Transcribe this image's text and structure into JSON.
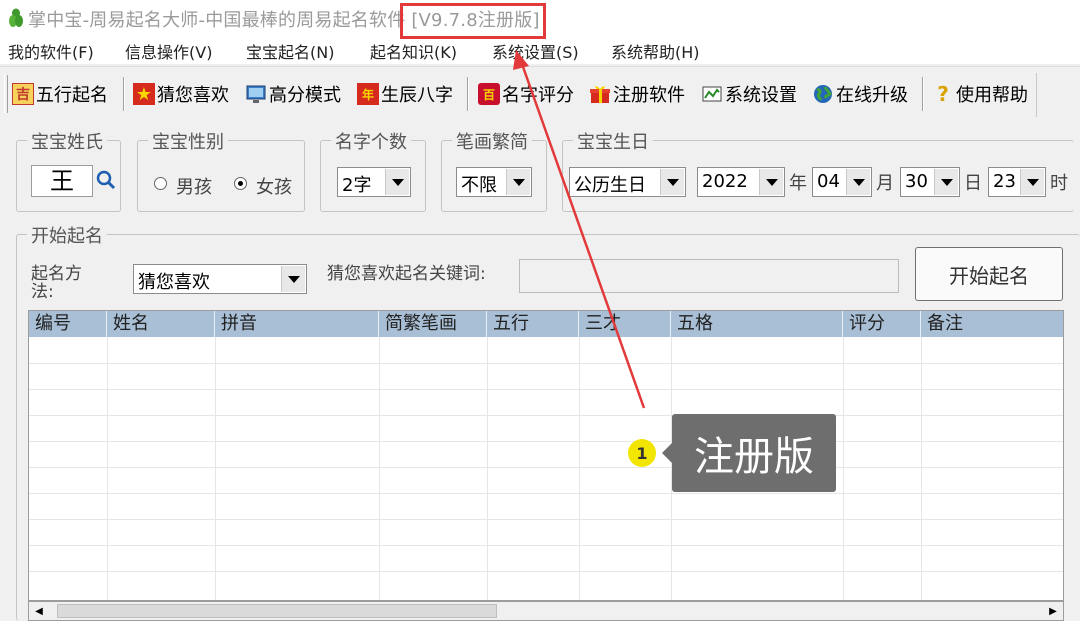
{
  "window": {
    "title_main": "掌中宝-周易起名大师-中国最棒的周易起名软件",
    "title_version": "[V9.7.8注册版]"
  },
  "menu": [
    "我的软件(F)",
    "信息操作(V)",
    "宝宝起名(N)",
    "起名知识(K)",
    "系统设置(S)",
    "系统帮助(H)"
  ],
  "toolbar": [
    {
      "label": "五行起名",
      "icon": "wuxing-icon"
    },
    {
      "label": "猜您喜欢",
      "icon": "star-icon"
    },
    {
      "label": "高分模式",
      "icon": "monitor-icon"
    },
    {
      "label": "生辰八字",
      "icon": "calendar-icon"
    },
    {
      "label": "名字评分",
      "icon": "badge-icon"
    },
    {
      "label": "注册软件",
      "icon": "gift-icon"
    },
    {
      "label": "系统设置",
      "icon": "settings-icon"
    },
    {
      "label": "在线升级",
      "icon": "globe-icon"
    },
    {
      "label": "使用帮助",
      "icon": "help-icon"
    }
  ],
  "surname": {
    "title": "宝宝姓氏",
    "value": "王"
  },
  "gender": {
    "title": "宝宝性别",
    "options": [
      "男孩",
      "女孩"
    ],
    "selected": "女孩"
  },
  "name_count": {
    "title": "名字个数",
    "value": "2字"
  },
  "stroke": {
    "title": "笔画繁简",
    "value": "不限"
  },
  "birthday": {
    "title": "宝宝生日",
    "calendar": "公历生日",
    "year": "2022",
    "year_unit": "年",
    "month": "04",
    "month_unit": "月",
    "day": "30",
    "day_unit": "日",
    "hour": "23",
    "hour_unit": "时"
  },
  "naming": {
    "title": "开始起名",
    "method_label": "起名方法:",
    "method_value": "猜您喜欢",
    "keyword_label": "猜您喜欢起名关键词:",
    "keyword_value": "",
    "start_button": "开始起名"
  },
  "grid": {
    "columns": [
      "编号",
      "姓名",
      "拼音",
      "简繁笔画",
      "五行",
      "三才",
      "五格",
      "评分",
      "备注"
    ],
    "rows": []
  },
  "annotation": {
    "badge": "1",
    "text": "注册版"
  },
  "colors": {
    "highlight": "#e23a3a",
    "header": "#a9bfd6",
    "callout": "#6e6e6e",
    "badge": "#f2e600"
  }
}
